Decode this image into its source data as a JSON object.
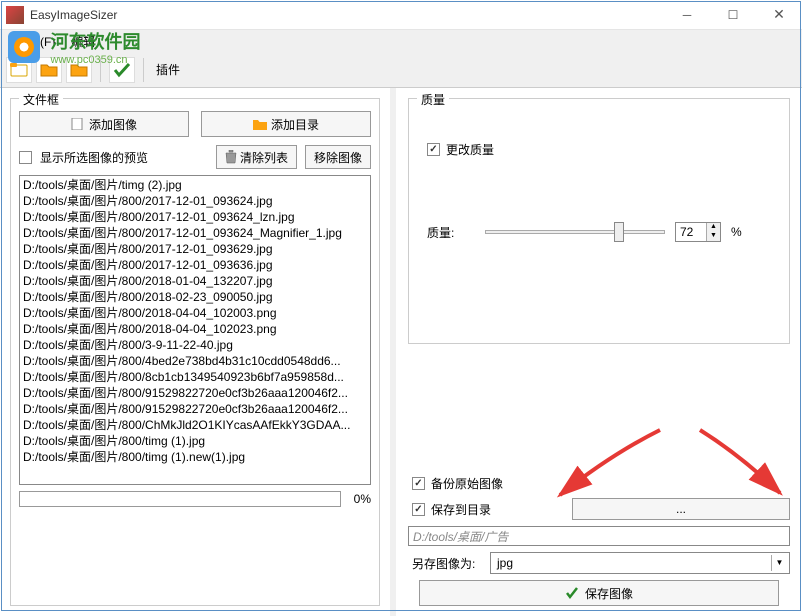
{
  "window": {
    "title": "EasyImageSizer"
  },
  "menu": {
    "file": "文件(F)",
    "edit": "编辑"
  },
  "watermark": {
    "name": "河东软件园",
    "url": "www.pc0359.cn"
  },
  "toolbar": {
    "plugins": "插件"
  },
  "left": {
    "group_label": "文件框",
    "add_image_btn": "添加图像",
    "add_folder_btn": "添加目录",
    "show_preview": "显示所选图像的预览",
    "clear_list_btn": "清除列表",
    "remove_image_btn": "移除图像",
    "progress_pct": "0%",
    "files": [
      "D:/tools/桌面/图片/timg (2).jpg",
      "D:/tools/桌面/图片/800/2017-12-01_093624.jpg",
      "D:/tools/桌面/图片/800/2017-12-01_093624_lzn.jpg",
      "D:/tools/桌面/图片/800/2017-12-01_093624_Magnifier_1.jpg",
      "D:/tools/桌面/图片/800/2017-12-01_093629.jpg",
      "D:/tools/桌面/图片/800/2017-12-01_093636.jpg",
      "D:/tools/桌面/图片/800/2018-01-04_132207.jpg",
      "D:/tools/桌面/图片/800/2018-02-23_090050.jpg",
      "D:/tools/桌面/图片/800/2018-04-04_102003.png",
      "D:/tools/桌面/图片/800/2018-04-04_102023.png",
      "D:/tools/桌面/图片/800/3-9-11-22-40.jpg",
      "D:/tools/桌面/图片/800/4bed2e738bd4b31c10cdd0548dd6...",
      "D:/tools/桌面/图片/800/8cb1cb1349540923b6bf7a959858d...",
      "D:/tools/桌面/图片/800/91529822720e0cf3b26aaa120046f2...",
      "D:/tools/桌面/图片/800/91529822720e0cf3b26aaa120046f2...",
      "D:/tools/桌面/图片/800/ChMkJld2O1KIYcasAAfEkkY3GDAA...",
      "D:/tools/桌面/图片/800/timg (1).jpg",
      "D:/tools/桌面/图片/800/timg (1).new(1).jpg"
    ]
  },
  "right": {
    "quality_label": "质量",
    "change_quality": "更改质量",
    "quality_field_label": "质量:",
    "quality_value": "72",
    "quality_percent": "%",
    "backup_original": "备份原始图像",
    "save_to_dir": "保存到目录",
    "browse_btn": "...",
    "save_path": "D:/tools/桌面/广告",
    "save_as_label": "另存图像为:",
    "format": "jpg",
    "save_btn": "保存图像"
  }
}
